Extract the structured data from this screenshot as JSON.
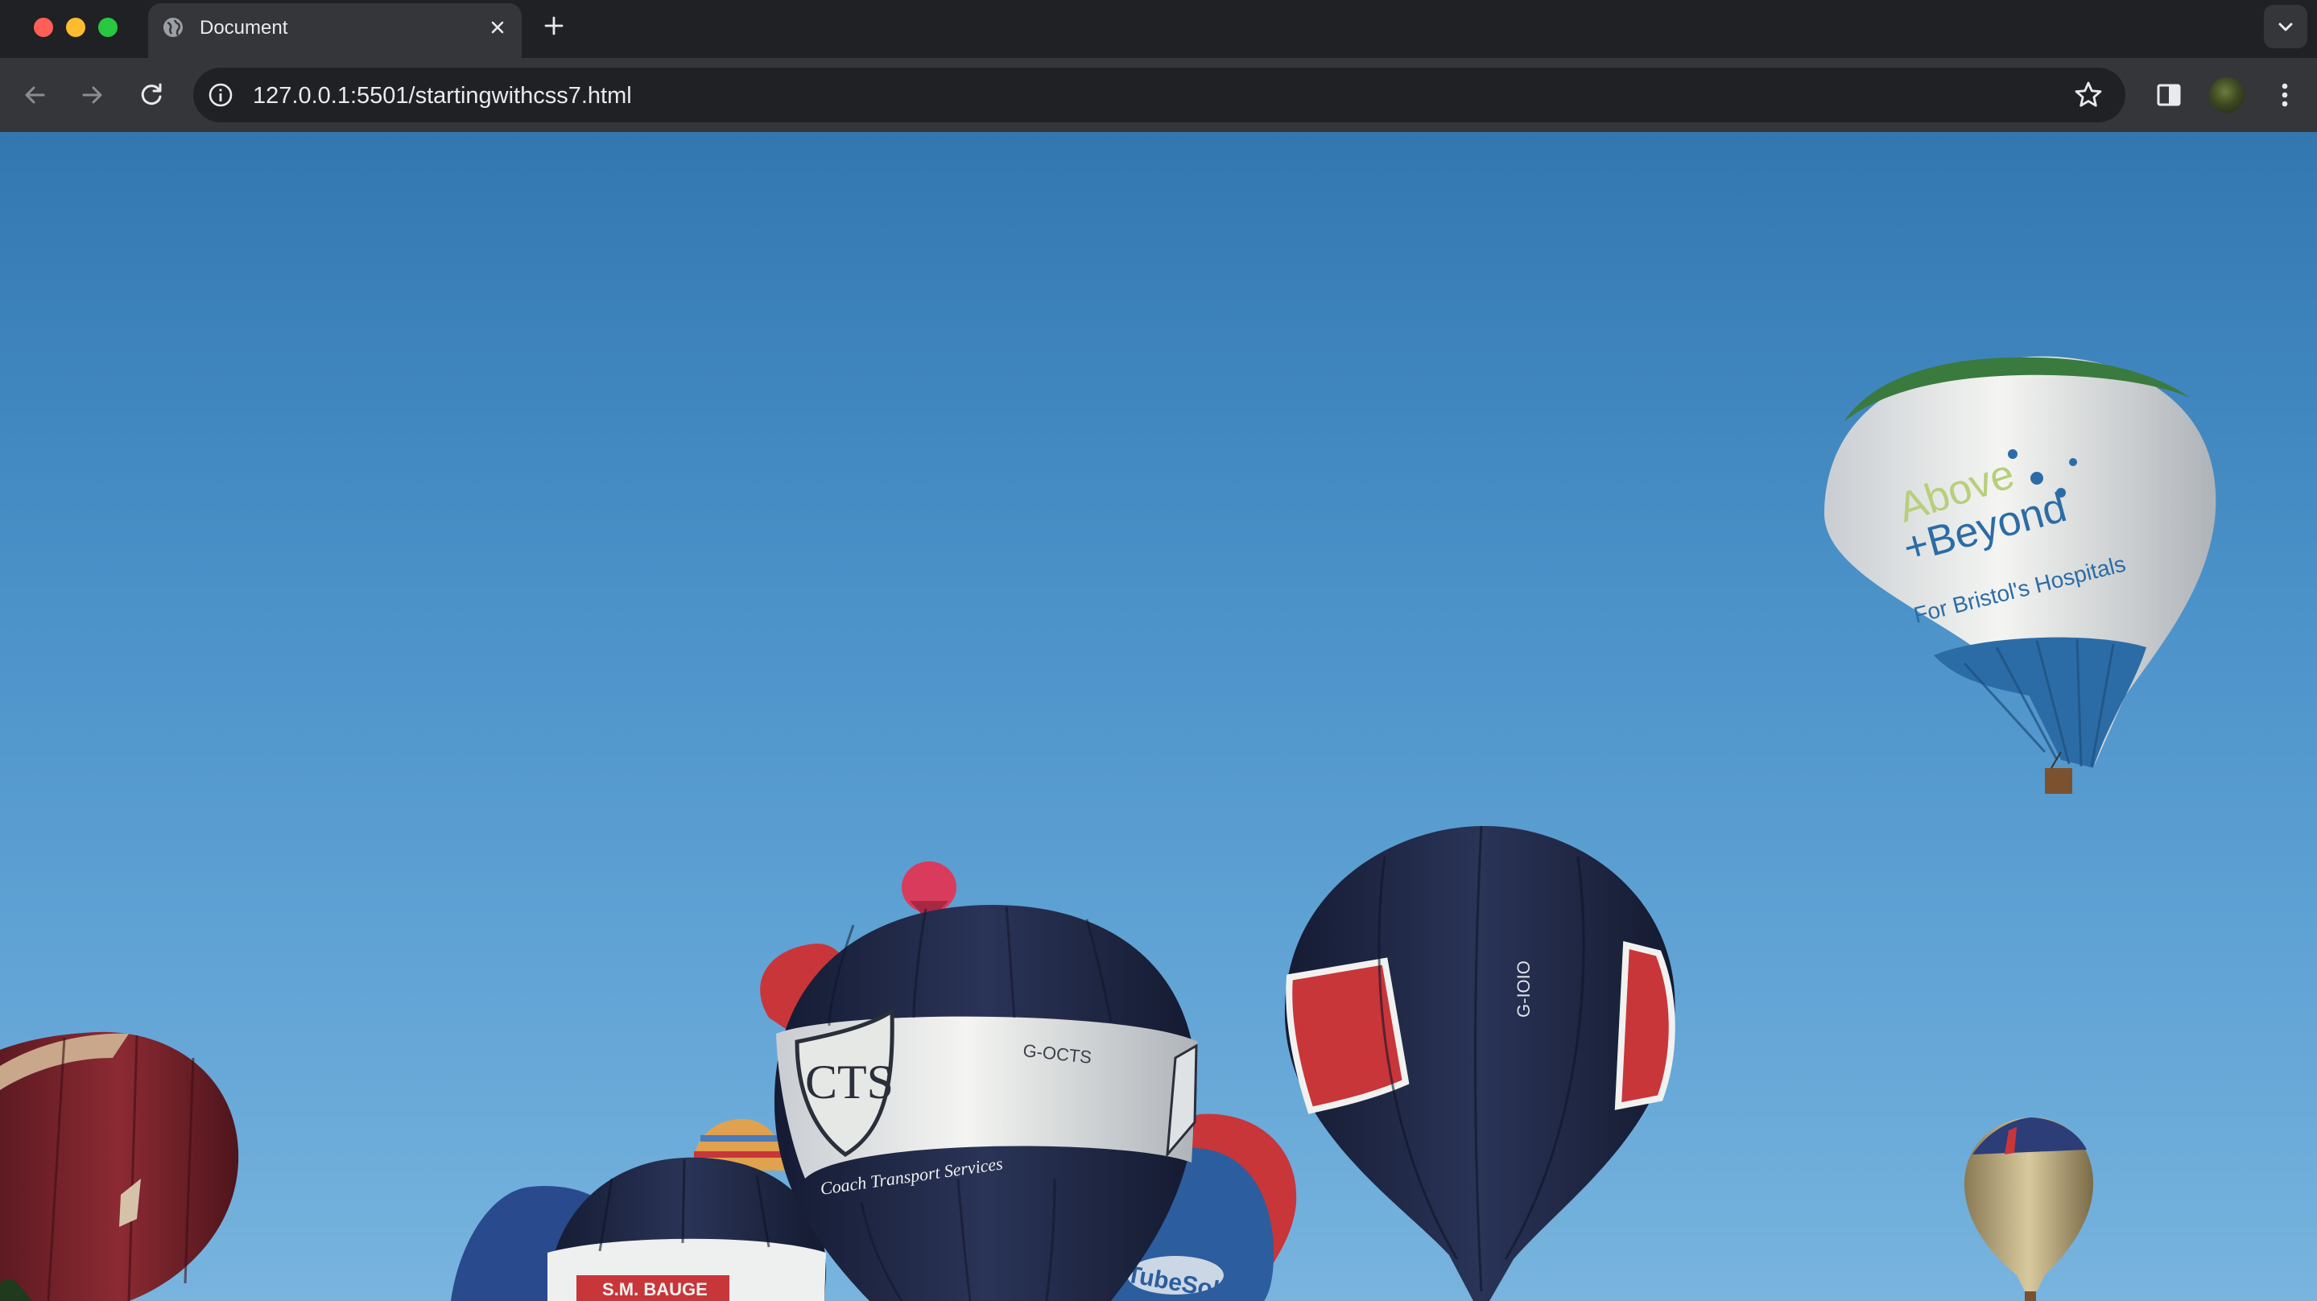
{
  "browser": {
    "tab": {
      "title": "Document",
      "favicon": "globe-icon"
    },
    "address_bar": {
      "url": "127.0.0.1:5501/startingwithcss7.html",
      "info_icon": "info-icon"
    },
    "colors": {
      "frame": "#202124",
      "toolbar": "#35363a",
      "text": "#e8eaed"
    }
  },
  "page": {
    "image": {
      "description_icon": "hot-air-balloons-photo",
      "balloon_texts": {
        "above_beyond": "Above",
        "beyond": "+Beyond",
        "hospitals": "For Bristol's Hospitals",
        "cts": "CTS",
        "cts_reg": "G-OCTS",
        "cts_tagline": "Coach Transport Services",
        "sm_bauge": "S.M. BAUGE",
        "tubesol": "TubeSol",
        "dark_reg": "G-IOIO"
      },
      "colors": {
        "sky_top": "#3377b1",
        "sky_bottom": "#78b4de",
        "navy": "#1f2744",
        "red": "#c8363a",
        "white": "#f1f2ef",
        "green": "#3a7a3e",
        "blue": "#2c6ca6"
      }
    }
  }
}
